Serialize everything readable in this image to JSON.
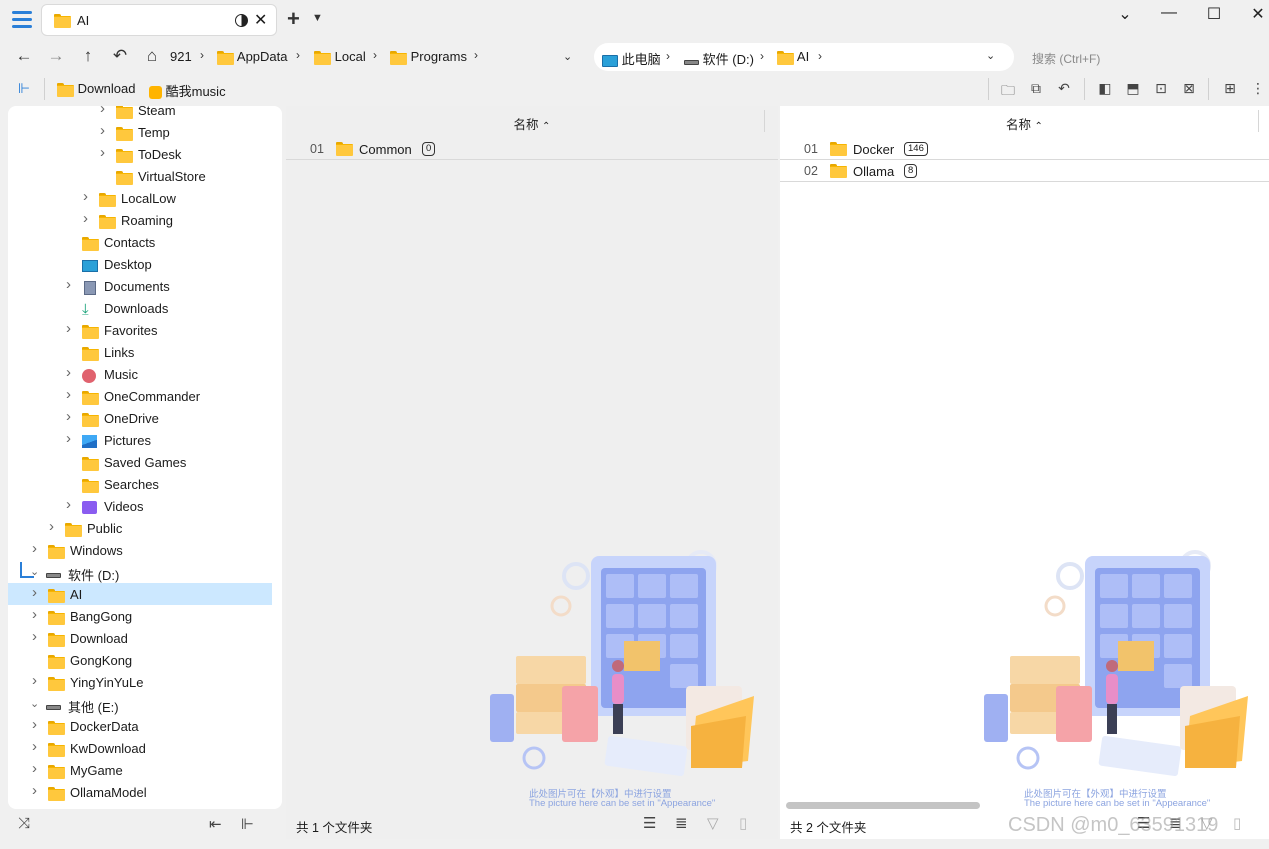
{
  "tab": {
    "title": "AI"
  },
  "nav": {
    "breadcrumb": [
      "921",
      "AppData",
      "Local",
      "Programs"
    ]
  },
  "address": {
    "segments": [
      "此电脑",
      "软件 (D:)",
      "AI"
    ]
  },
  "search": {
    "placeholder": "搜索 (Ctrl+F)"
  },
  "bookmarks": [
    {
      "label": "Download",
      "icon": "folder-icon"
    },
    {
      "label": "酷我music",
      "icon": "kuwo-music-icon"
    }
  ],
  "tree": {
    "items": [
      {
        "label": "Steam",
        "depth": 5,
        "expandable": true,
        "icon": "folder"
      },
      {
        "label": "Temp",
        "depth": 5,
        "expandable": true,
        "icon": "folder"
      },
      {
        "label": "ToDesk",
        "depth": 5,
        "expandable": true,
        "icon": "folder"
      },
      {
        "label": "VirtualStore",
        "depth": 5,
        "expandable": false,
        "icon": "folder"
      },
      {
        "label": "LocalLow",
        "depth": 4,
        "expandable": true,
        "icon": "folder"
      },
      {
        "label": "Roaming",
        "depth": 4,
        "expandable": true,
        "icon": "folder"
      },
      {
        "label": "Contacts",
        "depth": 3,
        "expandable": false,
        "icon": "folder"
      },
      {
        "label": "Desktop",
        "depth": 3,
        "expandable": false,
        "icon": "desktop"
      },
      {
        "label": "Documents",
        "depth": 3,
        "expandable": true,
        "icon": "documents"
      },
      {
        "label": "Downloads",
        "depth": 3,
        "expandable": false,
        "icon": "download"
      },
      {
        "label": "Favorites",
        "depth": 3,
        "expandable": true,
        "icon": "folder"
      },
      {
        "label": "Links",
        "depth": 3,
        "expandable": false,
        "icon": "folder"
      },
      {
        "label": "Music",
        "depth": 3,
        "expandable": true,
        "icon": "music"
      },
      {
        "label": "OneCommander",
        "depth": 3,
        "expandable": true,
        "icon": "folder"
      },
      {
        "label": "OneDrive",
        "depth": 3,
        "expandable": true,
        "icon": "folder"
      },
      {
        "label": "Pictures",
        "depth": 3,
        "expandable": true,
        "icon": "pictures"
      },
      {
        "label": "Saved Games",
        "depth": 3,
        "expandable": false,
        "icon": "folder"
      },
      {
        "label": "Searches",
        "depth": 3,
        "expandable": false,
        "icon": "folder"
      },
      {
        "label": "Videos",
        "depth": 3,
        "expandable": true,
        "icon": "videos"
      },
      {
        "label": "Public",
        "depth": 2,
        "expandable": true,
        "icon": "folder"
      },
      {
        "label": "Windows",
        "depth": 1,
        "expandable": true,
        "icon": "folder"
      },
      {
        "label": "软件 (D:)",
        "depth": 0,
        "expandable": true,
        "expanded": true,
        "icon": "drive"
      },
      {
        "label": "AI",
        "depth": 1,
        "expandable": true,
        "icon": "folder",
        "selected": true
      },
      {
        "label": "BangGong",
        "depth": 1,
        "expandable": true,
        "icon": "folder"
      },
      {
        "label": "Download",
        "depth": 1,
        "expandable": true,
        "icon": "folder"
      },
      {
        "label": "GongKong",
        "depth": 1,
        "expandable": false,
        "icon": "folder"
      },
      {
        "label": "YingYinYuLe",
        "depth": 1,
        "expandable": true,
        "icon": "folder"
      },
      {
        "label": "其他 (E:)",
        "depth": 0,
        "expandable": true,
        "expanded": true,
        "icon": "drive"
      },
      {
        "label": "DockerData",
        "depth": 1,
        "expandable": true,
        "icon": "folder"
      },
      {
        "label": "KwDownload",
        "depth": 1,
        "expandable": true,
        "icon": "folder"
      },
      {
        "label": "MyGame",
        "depth": 1,
        "expandable": true,
        "icon": "folder"
      },
      {
        "label": "OllamaModel",
        "depth": 1,
        "expandable": true,
        "icon": "folder"
      }
    ]
  },
  "left_pane": {
    "column_name": "名称",
    "rows": [
      {
        "num": "01",
        "name": "Common",
        "count": "0"
      }
    ],
    "status": "共 1 个文件夹",
    "illustration_text_cn": "此处图片可在【外观】中进行设置",
    "illustration_text_en": "The picture here can be set in \"Appearance\""
  },
  "right_pane": {
    "column_name": "名称",
    "rows": [
      {
        "num": "01",
        "name": "Docker",
        "count": "146"
      },
      {
        "num": "02",
        "name": "Ollama",
        "count": "8"
      }
    ],
    "status": "共 2 个文件夹",
    "illustration_text_cn": "此处图片可在【外观】中进行设置",
    "illustration_text_en": "The picture here can be set in \"Appearance\""
  },
  "watermark": "CSDN @m0_63591319",
  "colors": {
    "accent": "#2a7fd8",
    "folder": "#ffc83d",
    "selection": "#cce8ff"
  }
}
